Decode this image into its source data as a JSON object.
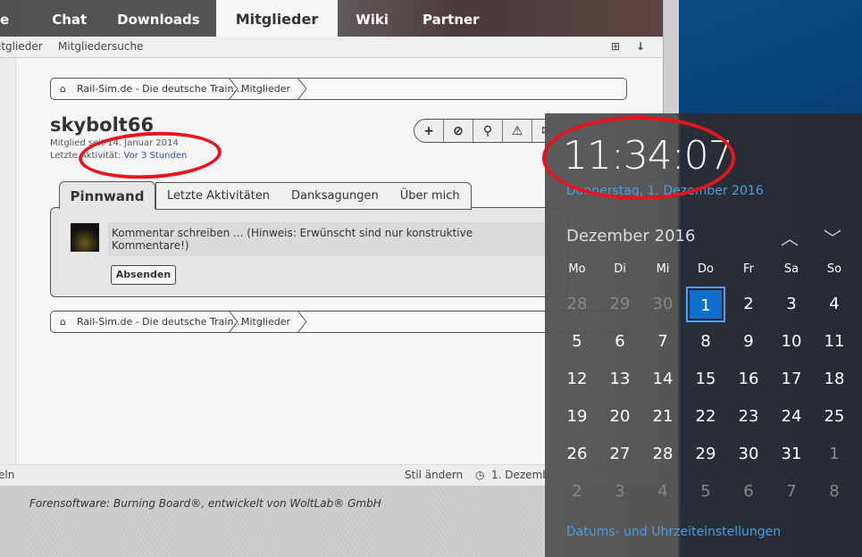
{
  "nav": {
    "tabs": [
      "e",
      "Chat",
      "Downloads",
      "Mitglieder",
      "Wiki",
      "Partner"
    ],
    "active": "Mitglieder"
  },
  "subnav": {
    "items": [
      "itglieder",
      "Mitgliedersuche"
    ]
  },
  "breadcrumb": {
    "home": "Rail-Sim.de - Die deutsche Train...",
    "current": "Mitglieder"
  },
  "profile": {
    "username": "skybolt66",
    "member_since_label": "Mitglied seit",
    "member_since": "14. Januar 2014",
    "last_activity_label": "Letzte Aktivität:",
    "last_activity": "Vor 3 Stunden",
    "tabs": [
      "Pinnwand",
      "Letzte Aktivitäten",
      "Danksagungen",
      "Über mich"
    ],
    "comment_placeholder": "Kommentar schreiben ... (Hinweis: Erwünscht sind nur konstruktive Kommentare!)",
    "send_label": "Absenden"
  },
  "footer": {
    "left": "eln",
    "style": "Stil ändern",
    "date": "1. Dezemb",
    "credit": "Forensoftware: Burning Board®, entwickelt von WoltLab® GmbH"
  },
  "clock": {
    "time": "11:34:07",
    "date": "Donnerstag, 1. Dezember 2016",
    "month": "Dezember 2016",
    "weekdays": [
      "Mo",
      "Di",
      "Mi",
      "Do",
      "Fr",
      "Sa",
      "So"
    ],
    "weeks": [
      [
        "28",
        "29",
        "30",
        "1",
        "2",
        "3",
        "4"
      ],
      [
        "5",
        "6",
        "7",
        "8",
        "9",
        "10",
        "11"
      ],
      [
        "12",
        "13",
        "14",
        "15",
        "16",
        "17",
        "18"
      ],
      [
        "19",
        "20",
        "21",
        "22",
        "23",
        "24",
        "25"
      ],
      [
        "26",
        "27",
        "28",
        "29",
        "30",
        "31",
        "1"
      ],
      [
        "2",
        "3",
        "4",
        "5",
        "6",
        "7",
        "8"
      ]
    ],
    "today": "1",
    "settings_link": "Datums- und Uhrzeiteinstellungen",
    "accent": "#0a6fcf"
  }
}
